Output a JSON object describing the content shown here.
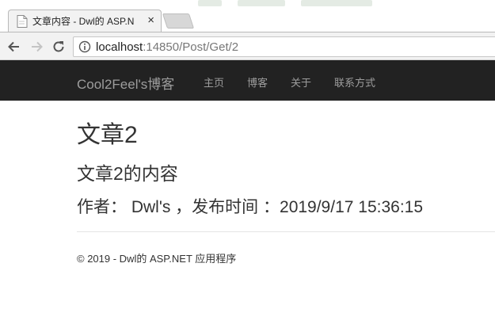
{
  "browser": {
    "tab": {
      "title": "文章内容 - Dwl的 ASP.N",
      "close_glyph": "×"
    },
    "address_bar": {
      "host": "localhost",
      "path": ":14850/Post/Get/2"
    },
    "icons": [
      "back-arrow-icon",
      "forward-arrow-icon",
      "reload-icon",
      "info-icon",
      "page-favicon-icon",
      "close-icon"
    ]
  },
  "navbar": {
    "brand": "Cool2Feel's博客",
    "links": [
      "主页",
      "博客",
      "关于",
      "联系方式"
    ],
    "background": "#222222",
    "link_color": "#9d9d9d"
  },
  "post": {
    "title": "文章2",
    "content": "文章2的内容",
    "meta": "作者： Dwl's ，发布时间 ：2019/9/17 15:36:15"
  },
  "footer": {
    "text": "© 2019 - Dwl的 ASP.NET 应用程序"
  }
}
